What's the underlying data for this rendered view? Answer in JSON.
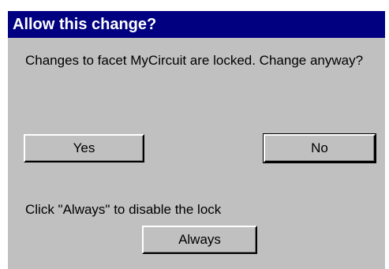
{
  "dialog": {
    "title": "Allow this change?",
    "message": "Changes to facet MyCircuit are locked.  Change anyway?",
    "hint": "Click \"Always\" to disable the lock",
    "buttons": {
      "yes": "Yes",
      "no": "No",
      "always": "Always"
    },
    "colors": {
      "title_bar": "#000080",
      "title_text": "#ffffff",
      "face": "#c0c0c0"
    }
  }
}
